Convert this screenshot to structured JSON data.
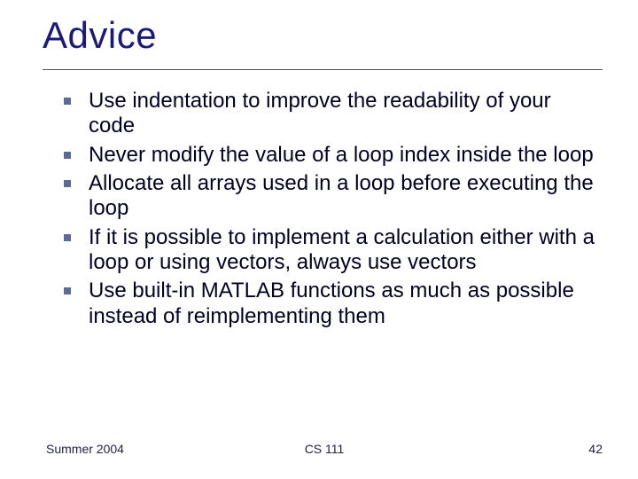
{
  "title": "Advice",
  "bullets": [
    "Use indentation to improve the readability of your code",
    "Never modify the value of a loop index inside the loop",
    "Allocate all arrays used in a loop before executing the loop",
    "If it is possible to implement a calculation either with a loop or using vectors, always use vectors",
    "Use built-in MATLAB functions as much as possible instead of reimplementing them"
  ],
  "footer": {
    "left": "Summer 2004",
    "center": "CS 111",
    "right": "42"
  }
}
